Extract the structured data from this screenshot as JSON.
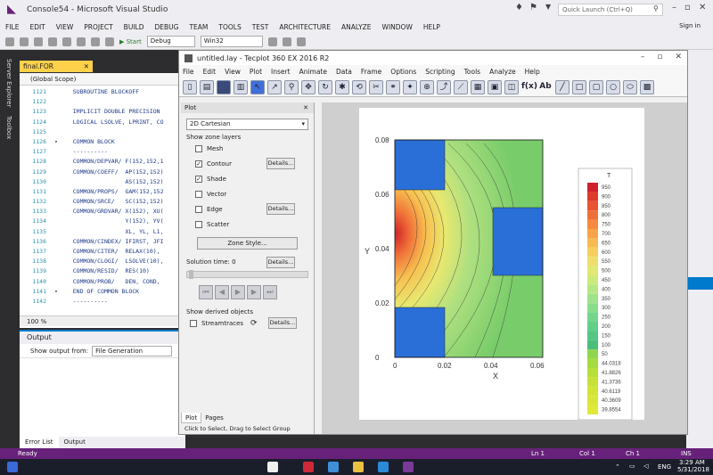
{
  "vs": {
    "title": "Console54 - Microsoft Visual Studio",
    "quick_launch": "Quick Launch (Ctrl+Q)",
    "menu": [
      "FILE",
      "EDIT",
      "VIEW",
      "PROJECT",
      "BUILD",
      "DEBUG",
      "TEAM",
      "TOOLS",
      "TEST",
      "ARCHITECTURE",
      "ANALYZE",
      "WINDOW",
      "HELP"
    ],
    "sign_in": "Sign in",
    "toolbar": {
      "start": "Start",
      "config": "Debug",
      "platform": "Win32"
    },
    "side_tabs": [
      "Server Explorer",
      "Toolbox"
    ],
    "doc_tab": "final.FOR",
    "scope": "(Global Scope)",
    "zoom": "100 %",
    "code_lines": [
      {
        "n": "1121",
        "m": "",
        "t": "   SUBROUTINE BLOCKOFF"
      },
      {
        "n": "1122",
        "m": "",
        "t": ""
      },
      {
        "n": "1123",
        "m": "",
        "t": "   IMPLICIT DOUBLE PRECISION"
      },
      {
        "n": "1124",
        "m": "",
        "t": "   LOGICAL LSOLVE, LPRINT, CO"
      },
      {
        "n": "1125",
        "m": "",
        "t": ""
      },
      {
        "n": "1126",
        "m": "▾",
        "t": "   COMMON BLOCK"
      },
      {
        "n": "1127",
        "m": "",
        "t": "   ----------"
      },
      {
        "n": "1128",
        "m": "",
        "t": "   COMMON/DEPVAR/ F(152,152,1"
      },
      {
        "n": "1129",
        "m": "",
        "t": "   COMMON/COEFF/  AP(152,152)"
      },
      {
        "n": "1130",
        "m": "",
        "t": "                  AS(152,152)"
      },
      {
        "n": "1131",
        "m": "",
        "t": "   COMMON/PROPS/  GAM(152,152"
      },
      {
        "n": "1132",
        "m": "",
        "t": "   COMMON/SRCE/   SC(152,152)"
      },
      {
        "n": "1133",
        "m": "",
        "t": "   COMMON/GRDVAR/ X(152), XU("
      },
      {
        "n": "1134",
        "m": "",
        "t": "                  Y(152), YV("
      },
      {
        "n": "1135",
        "m": "",
        "t": "                  XL, YL, L1,"
      },
      {
        "n": "1136",
        "m": "",
        "t": "   COMMON/CINDEX/ IFIRST, JFI"
      },
      {
        "n": "1137",
        "m": "",
        "t": "   COMMON/CITER/  RELAX(10),"
      },
      {
        "n": "1138",
        "m": "",
        "t": "   COMMON/CLOGI/  LSOLVE(10),"
      },
      {
        "n": "1139",
        "m": "",
        "t": "   COMMON/RESID/  RES(10)"
      },
      {
        "n": "1140",
        "m": "",
        "t": "   COMMON/PROB/   DEN, COND,"
      },
      {
        "n": "1141",
        "m": "▾",
        "t": "   END OF COMMON BLOCK"
      },
      {
        "n": "1142",
        "m": "",
        "t": "   ----------"
      }
    ],
    "output": {
      "title": "Output",
      "show_from": "Show output from:",
      "source": "File Generation"
    },
    "bottom_tabs": [
      "Error List",
      "Output"
    ],
    "status": {
      "ready": "Ready",
      "ln": "Ln 1",
      "col": "Col 1",
      "ch": "Ch 1",
      "ins": "INS"
    },
    "tray": {
      "lang": "ENG",
      "time": "3:29 AM",
      "date": "5/31/2018"
    }
  },
  "tecplot": {
    "title": "untitled.lay - Tecplot 360 EX 2016 R2",
    "menu": [
      "File",
      "Edit",
      "View",
      "Plot",
      "Insert",
      "Animate",
      "Data",
      "Frame",
      "Options",
      "Scripting",
      "Tools",
      "Analyze",
      "Help"
    ],
    "panel": {
      "header": "Plot",
      "plot_type": "2D Cartesian",
      "zone_layers_label": "Show zone layers",
      "layers": [
        {
          "label": "Mesh",
          "checked": false,
          "details": false
        },
        {
          "label": "Contour",
          "checked": true,
          "details": true
        },
        {
          "label": "Shade",
          "checked": true,
          "details": false
        },
        {
          "label": "Vector",
          "checked": false,
          "details": false
        },
        {
          "label": "Edge",
          "checked": false,
          "details": true
        },
        {
          "label": "Scatter",
          "checked": false,
          "details": false
        }
      ],
      "details_label": "Details...",
      "zone_style": "Zone Style...",
      "solution_time_label": "Solution time:",
      "solution_time": "0",
      "derived_label": "Show derived objects",
      "streamtraces": "Streamtraces",
      "tabs": [
        "Plot",
        "Pages"
      ],
      "status": "Click to Select, Drag to Select Group"
    },
    "plot": {
      "x_ticks": [
        "0",
        "0.02",
        "0.04",
        "0.06"
      ],
      "y_ticks": [
        "0",
        "0.02",
        "0.04",
        "0.06",
        "0.08"
      ],
      "xlabel": "X",
      "ylabel": "Y",
      "legend_title": "T",
      "legend_levels": [
        "950",
        "900",
        "850",
        "800",
        "750",
        "700",
        "650",
        "600",
        "550",
        "500",
        "450",
        "400",
        "350",
        "300",
        "250",
        "200",
        "150",
        "100",
        "50",
        "44.0318",
        "41.8826",
        "41.3736",
        "40.6119",
        "40.3609",
        "39.8554"
      ],
      "legend_colors": [
        "#d0202a",
        "#dd3b2a",
        "#e85530",
        "#ef6f38",
        "#f58a40",
        "#f8a448",
        "#f8bb52",
        "#f6cf5e",
        "#efde6a",
        "#e2e874",
        "#cdeb7c",
        "#b5e884",
        "#9ee38a",
        "#88dd8c",
        "#74d68c",
        "#62cf88",
        "#55c683",
        "#4cbd7c",
        "#8fd64e",
        "#a6dc3f",
        "#b8e03a",
        "#c7e237",
        "#d2e435",
        "#dae636",
        "#e0e838"
      ]
    }
  }
}
